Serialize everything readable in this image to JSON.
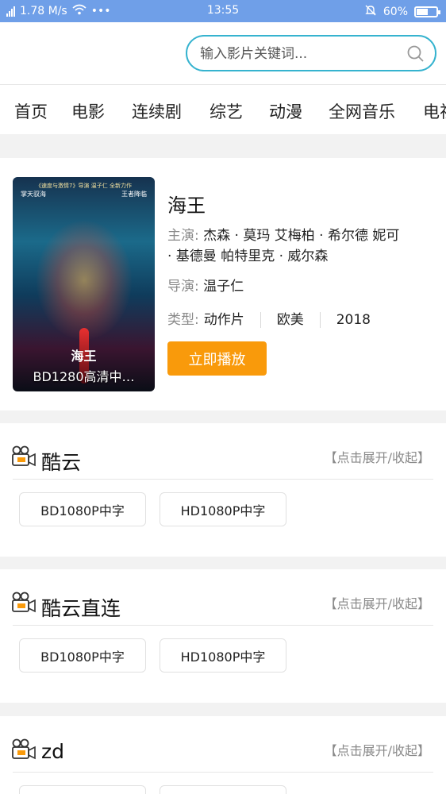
{
  "status_bar": {
    "network_type": "2G",
    "speed": "1.78 M/s",
    "more": "•••",
    "time": "13:55",
    "battery": "60%",
    "battery_level": 0.6
  },
  "search": {
    "placeholder": "输入影片关键词..."
  },
  "nav": {
    "tabs": [
      "首页",
      "电影",
      "连续剧",
      "综艺",
      "动漫",
      "全网音乐",
      "电视"
    ],
    "active": 1
  },
  "movie": {
    "title": "海王",
    "cast_label": "主演:",
    "cast": "杰森 · 莫玛 艾梅柏 · 希尔德 妮可 · 基德曼 帕特里克 · 威尔森",
    "director_label": "导演:",
    "director": "温子仁",
    "genre_label": "类型:",
    "genre": "动作片",
    "region": "欧美",
    "year": "2018",
    "play_label": "立即播放",
    "poster": {
      "tagline": "《速度与激情7》导演 温子仁 全新力作",
      "left_name": "掌天驭海",
      "right_name": "王者降临",
      "title": "海王",
      "caption": "BD1280高清中…"
    }
  },
  "sources": [
    {
      "title": "酷云",
      "toggle": "【点击展开/收起】",
      "episodes": [
        "BD1080P中字",
        "HD1080P中字"
      ]
    },
    {
      "title": "酷云直连",
      "toggle": "【点击展开/收起】",
      "episodes": [
        "BD1080P中字",
        "HD1080P中字"
      ]
    },
    {
      "title": "zd",
      "toggle": "【点击展开/收起】",
      "episodes": [
        "",
        ""
      ]
    }
  ],
  "colors": {
    "status_bar": "#6f9fe8",
    "accent_orange": "#f99a0b",
    "search_border": "#36b3cf"
  }
}
